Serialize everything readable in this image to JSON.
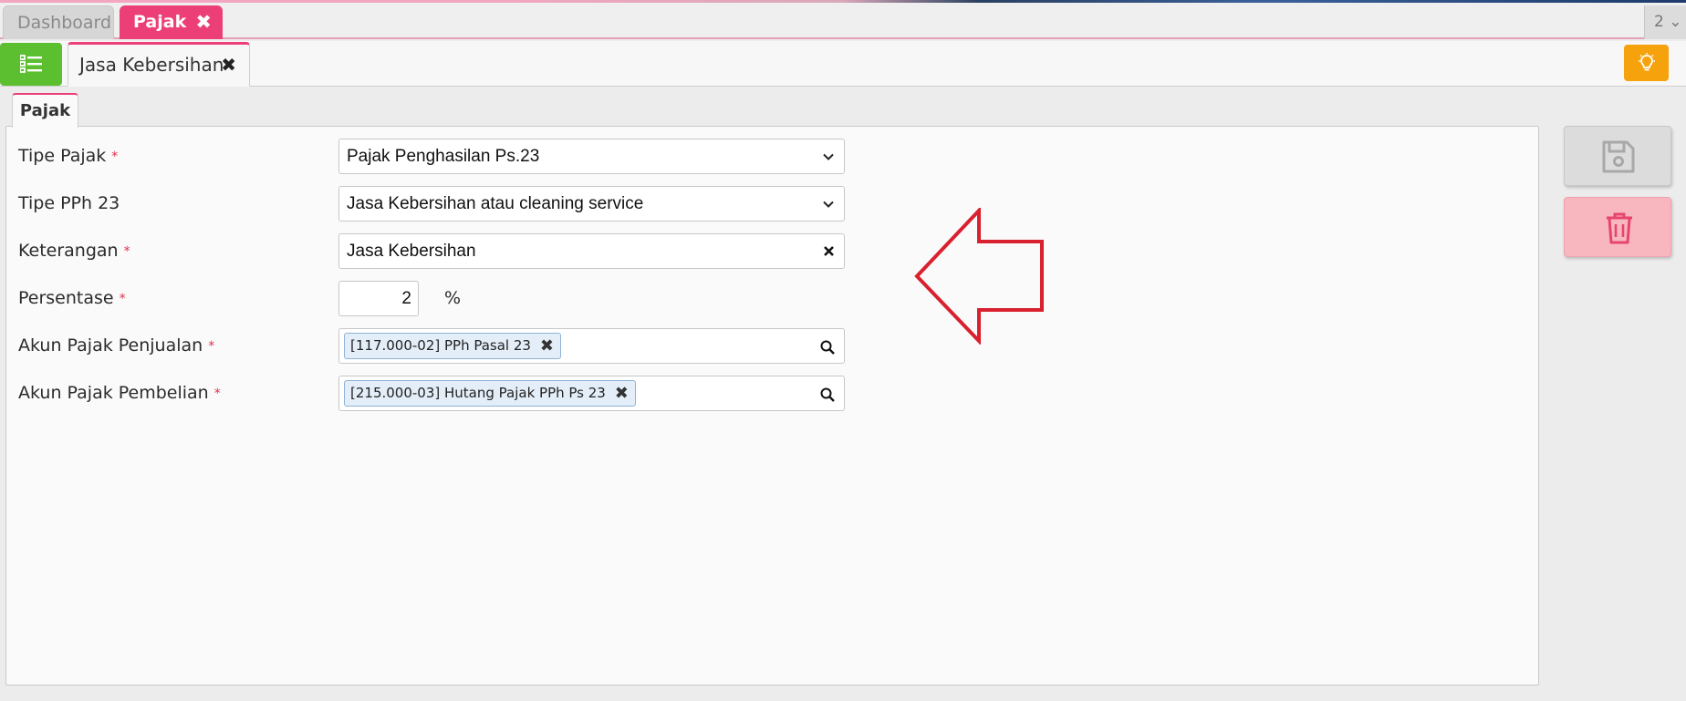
{
  "top_tabs": [
    {
      "label": "Dashboard",
      "active": false
    },
    {
      "label": "Pajak",
      "active": true,
      "close_icon": "✖"
    }
  ],
  "window_counter": {
    "label": "2 ⌄"
  },
  "record_tab": {
    "label": "Jasa Kebersihan",
    "close_icon": "✖"
  },
  "section_tab": {
    "label": "Pajak"
  },
  "form": {
    "required_marker": "*",
    "tipe_pajak": {
      "label": "Tipe Pajak",
      "required": true,
      "value": "Pajak Penghasilan Ps.23"
    },
    "tipe_pph23": {
      "label": "Tipe PPh 23",
      "required": false,
      "value": "Jasa Kebersihan atau cleaning service"
    },
    "keterangan": {
      "label": "Keterangan",
      "required": true,
      "value": "Jasa Kebersihan"
    },
    "persentase": {
      "label": "Persentase",
      "required": true,
      "value": "2",
      "unit": "%"
    },
    "akun_penjualan": {
      "label": "Akun Pajak Penjualan",
      "required": true,
      "tag": "[117.000-02] PPh Pasal 23"
    },
    "akun_pembelian": {
      "label": "Akun Pajak Pembelian",
      "required": true,
      "tag": "[215.000-03] Hutang Pajak PPh Ps 23"
    }
  },
  "icons": {
    "menu": "list-icon",
    "tip": "lightbulb-icon",
    "save": "floppy-disk-icon",
    "delete": "trash-icon",
    "dropdown": "chevron-down-icon",
    "clear": "close-icon",
    "search": "search-icon",
    "annotation": "arrow-left-annotation"
  },
  "colors": {
    "accent_pink": "#ec3f77",
    "menu_green": "#5cbf2f",
    "tip_orange": "#f5a20c",
    "delete_bg": "#f8b7bf",
    "delete_icon": "#e8456c",
    "required_red": "#e0304f",
    "tag_bg": "#e4eef8",
    "annotation_red": "#d9202e"
  }
}
